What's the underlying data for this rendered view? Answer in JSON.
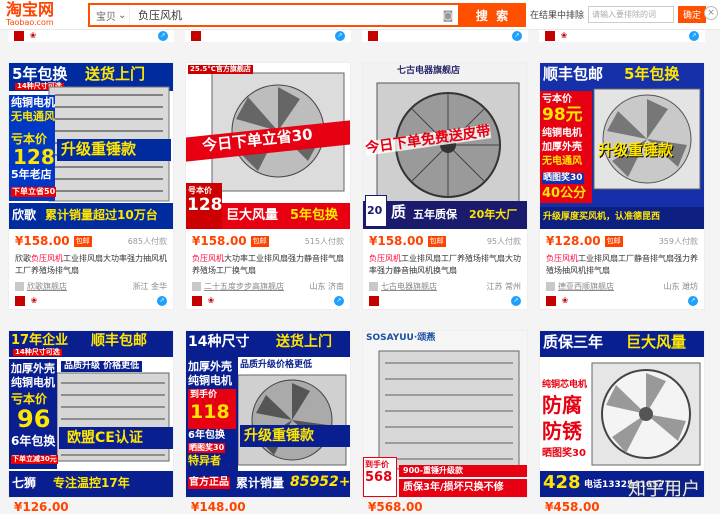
{
  "header": {
    "logo_cn": "淘宝网",
    "logo_en": "Taobao.com",
    "scope": "宝贝",
    "query": "负压风机",
    "search_btn": "搜 索",
    "filter_label": "在结果中排除",
    "filter_placeholder": "请输入要排除的词",
    "filter_btn": "确定"
  },
  "products": [
    {
      "price": "¥158.00",
      "post": "包邮",
      "sales": "685人付款",
      "title_pre": "欣歌",
      "title_hl": "负压风机",
      "title_post": "工业排风扇大功率强力抽风机工厂养殖场排气扇",
      "shop": "欣歌旗舰店",
      "loc": "浙江 金华",
      "img": {
        "t1": "5年包换",
        "t2": "送货上门",
        "t3": "14种尺寸可选",
        "t4": "纯铜电机",
        "t5": "无电通风",
        "t6": "亏本价",
        "t7": "128",
        "t8": "5年老店",
        "t9": "升级重锤款",
        "t10": "下单立省50",
        "t11": "欣歌",
        "t12": "累计销量超过10万台"
      }
    },
    {
      "price": "¥158.00",
      "post": "包邮",
      "sales": "515人付款",
      "title_pre": "",
      "title_hl": "负压风机",
      "title_post": "大功率工业排风扇强力静音排气扇养殖场工厂换气扇",
      "shop": "二十五度步步高旗舰店",
      "loc": "山东 济南",
      "img": {
        "t1": "25.5°C官方旗舰店",
        "t2": "今日下单立省30",
        "t3": "号本价",
        "t4": "128",
        "t5": "巨大风量",
        "t6": "5年包换",
        "t7": "25.5°C"
      }
    },
    {
      "price": "¥158.00",
      "post": "包邮",
      "sales": "95人付款",
      "title_pre": "",
      "title_hl": "负压风机",
      "title_post": "工业排风扇工厂养殖场排气扇大功率强力静音抽风机换气扇",
      "shop": "七古电器旗舰店",
      "loc": "江苏 常州",
      "img": {
        "t1": "七古电器旗舰店",
        "t2": "今日下单免费送皮带",
        "t3": "20",
        "t4": "质",
        "t5": "五年质保",
        "t6": "20年大厂"
      }
    },
    {
      "price": "¥128.00",
      "post": "包邮",
      "sales": "359人付款",
      "title_pre": "",
      "title_hl": "负压风机",
      "title_post": "工业排风扇工厂静音排气扇强力养殖场抽风机排气扇",
      "shop": "德亚西顺旗舰店",
      "loc": "山东 潍坊",
      "img": {
        "t1": "顺丰包邮",
        "t2": "5年包换",
        "t3": "亏本价",
        "t4": "98元",
        "t5": "纯铜电机",
        "t6": "加厚外壳",
        "t7": "无电通风",
        "t8": "升级重锤款",
        "t9": "晒图奖30",
        "t10": "40公分",
        "t11": "升级厚度买风机，认准德昆西"
      }
    },
    {
      "price": "¥126.00",
      "sales": "",
      "img": {
        "t1": "17年企业",
        "t2": "顺丰包邮",
        "t3": "14种尺寸可选",
        "t4": "加厚外壳",
        "t5": "纯铜电机",
        "t6": "亏本价",
        "t7": "96",
        "t8": "6年包换",
        "t9": "品质升级 价格更低",
        "t10": "欧盟CE认证",
        "t11": "七狮",
        "t12": "专注温控17年",
        "t13": "下单立减30元"
      }
    },
    {
      "price": "¥148.00",
      "img": {
        "t1": "14种尺寸",
        "t2": "送货上门",
        "t3": "加厚外壳",
        "t4": "纯铜电机",
        "t5": "品质升级价格更低",
        "t6": "到手价",
        "t7": "118",
        "t8": "6年包换",
        "t9": "升级重锤款",
        "t10": "晒图奖30",
        "t11": "特异者",
        "t12": "官方正品",
        "t13": "累计销量",
        "t14": "85952+"
      }
    },
    {
      "price": "¥568.00",
      "img": {
        "t1": "SOSAYUU·颂燕",
        "t2": "到手价",
        "t3": "568",
        "t4": "900-重锤升级款",
        "t5": "质保3年/损坏只换不修"
      }
    },
    {
      "price": "¥458.00",
      "img": {
        "t1": "质保三年",
        "t2": "巨大风量",
        "t3": "纯铜芯电机",
        "t4": "防腐",
        "t5": "防锈",
        "t6": "晒图奖30",
        "t7": "428",
        "t8": "电话13325416577"
      }
    }
  ],
  "watermark": "知乎用户"
}
